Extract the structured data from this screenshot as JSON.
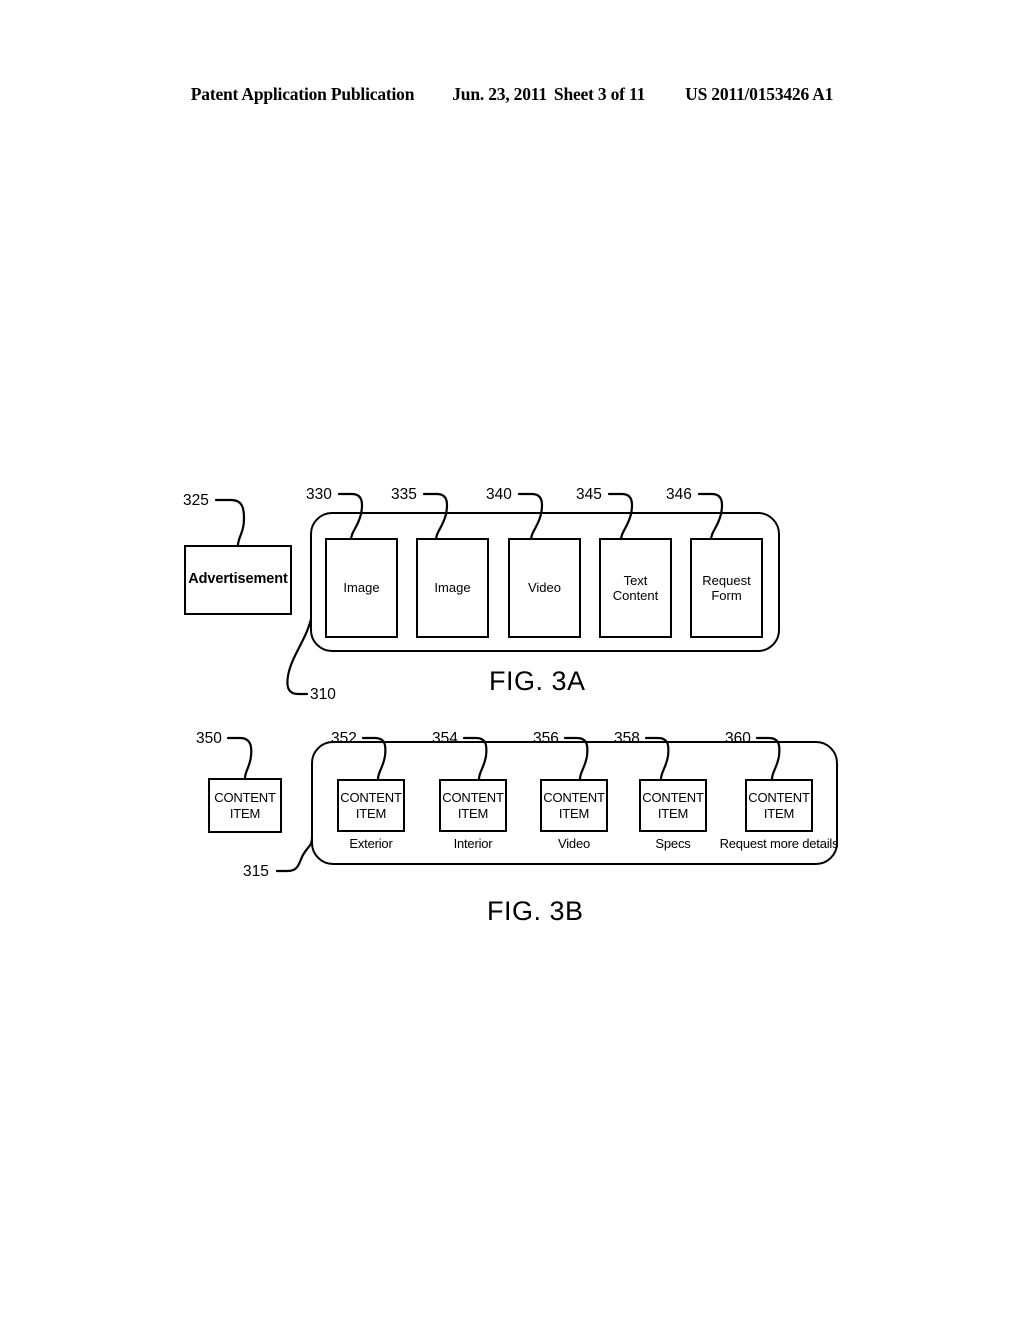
{
  "header": {
    "publication": "Patent Application Publication",
    "date": "Jun. 23, 2011",
    "sheet": "Sheet 3 of 11",
    "patent_number": "US 2011/0153426 A1"
  },
  "figures": [
    {
      "caption": "FIG. 3A",
      "container_ref": "310",
      "standalone": {
        "ref": "325",
        "label": "Advertisement"
      },
      "tiles": [
        {
          "ref": "330",
          "label": "Image"
        },
        {
          "ref": "335",
          "label": "Image"
        },
        {
          "ref": "340",
          "label": "Video"
        },
        {
          "ref": "345",
          "label": "Text Content"
        },
        {
          "ref": "346",
          "label": "Request Form"
        }
      ]
    },
    {
      "caption": "FIG. 3B",
      "container_ref": "315",
      "standalone": {
        "ref": "350",
        "label": "CONTENT ITEM"
      },
      "tiles": [
        {
          "ref": "352",
          "label": "CONTENT ITEM",
          "tab": "Exterior"
        },
        {
          "ref": "354",
          "label": "CONTENT ITEM",
          "tab": "Interior"
        },
        {
          "ref": "356",
          "label": "CONTENT ITEM",
          "tab": "Video"
        },
        {
          "ref": "358",
          "label": "CONTENT ITEM",
          "tab": "Specs"
        },
        {
          "ref": "360",
          "label": "CONTENT ITEM",
          "tab": "Request more details"
        }
      ]
    }
  ],
  "colors": {
    "ink": "#000000",
    "paper": "#ffffff"
  }
}
